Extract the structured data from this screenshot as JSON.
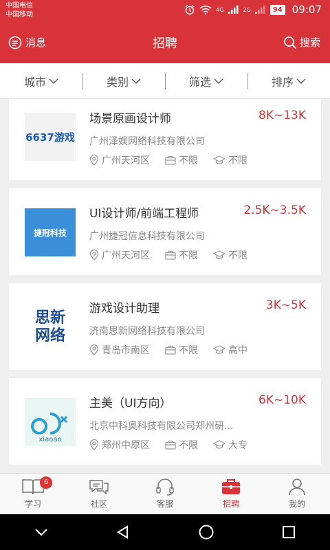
{
  "status_bar": {
    "carrier_1": "中国电信",
    "carrier_2": "中国移动",
    "network_1": "4G",
    "network_2": "2G",
    "battery": "94",
    "time": "09:07"
  },
  "header": {
    "left_label": "消息",
    "title": "招聘",
    "right_label": "搜索"
  },
  "filters": [
    {
      "label": "城市"
    },
    {
      "label": "类别"
    },
    {
      "label": "筛选"
    },
    {
      "label": "排序"
    }
  ],
  "jobs": [
    {
      "title": "场景原画设计师",
      "salary": "8K~13K",
      "company": "广州泽娱网络科技有限公司",
      "location": "广州天河区",
      "experience": "不限",
      "education": "不限",
      "logo_text": "6637游戏"
    },
    {
      "title": "UI设计师/前端工程师",
      "salary": "2.5K~3.5K",
      "company": "广州捷冠信息科技有限公司",
      "location": "广州天河区",
      "experience": "不限",
      "education": "不限",
      "logo_text": "捷冠科技"
    },
    {
      "title": "游戏设计助理",
      "salary": "3K~5K",
      "company": "济南思新网络科技有限公司",
      "location": "青岛市南区",
      "experience": "不限",
      "education": "高中",
      "logo_text_1": "思新",
      "logo_text_2": "网络"
    },
    {
      "title": "主美（UI方向）",
      "salary": "6K~10K",
      "company": "北京中科奥科技有限公司郑州研...",
      "location": "郑州中原区",
      "experience": "不限",
      "education": "大专",
      "logo_text": "xiaoao"
    }
  ],
  "tabs": [
    {
      "label": "学习",
      "badge": "6"
    },
    {
      "label": "社区"
    },
    {
      "label": "客服"
    },
    {
      "label": "招聘"
    },
    {
      "label": "我的"
    }
  ],
  "colors": {
    "accent": "#d9333a",
    "background": "#efefef"
  }
}
